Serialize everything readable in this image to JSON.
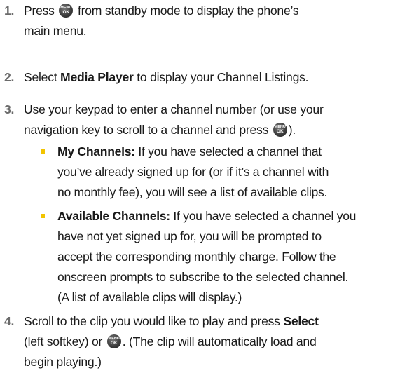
{
  "menu_key": {
    "top": "MENU",
    "bottom": "OK"
  },
  "bullet_color": "#f2c400",
  "steps": [
    {
      "num": "1.",
      "l1a": "Press ",
      "l1b": " from standby mode to display the phone’s",
      "l2": "main menu."
    },
    {
      "num": "2.",
      "pre": "Select ",
      "bold": "Media Player",
      "post": " to display your Channel Listings."
    },
    {
      "num": "3.",
      "l1": "Use your keypad to enter a channel number (or use your",
      "l2a": "navigation key to scroll to a channel and press ",
      "l2b": ")."
    },
    {
      "num": "4.",
      "l1a": "Scroll to the clip you would like to play and press ",
      "l1b": "Select",
      "l2a": "(left softkey) or ",
      "l2b": ". (The clip will automatically load and",
      "l3": "begin playing.)"
    }
  ],
  "bullets": [
    {
      "label": "My Channels:",
      "l1": " If you have selected a channel that",
      "l2": "you’ve already signed up for (or if it’s a channel with",
      "l3": "no monthly fee), you will see a list of available clips."
    },
    {
      "label": "Available Channels:",
      "l1": " If you have selected a channel you",
      "l2": "have not yet signed up for, you will be prompted to",
      "l3": "accept the corresponding monthly charge. Follow the",
      "l4": "onscreen prompts to subscribe to the selected channel.",
      "l5": "(A list of available clips will display.)"
    }
  ]
}
